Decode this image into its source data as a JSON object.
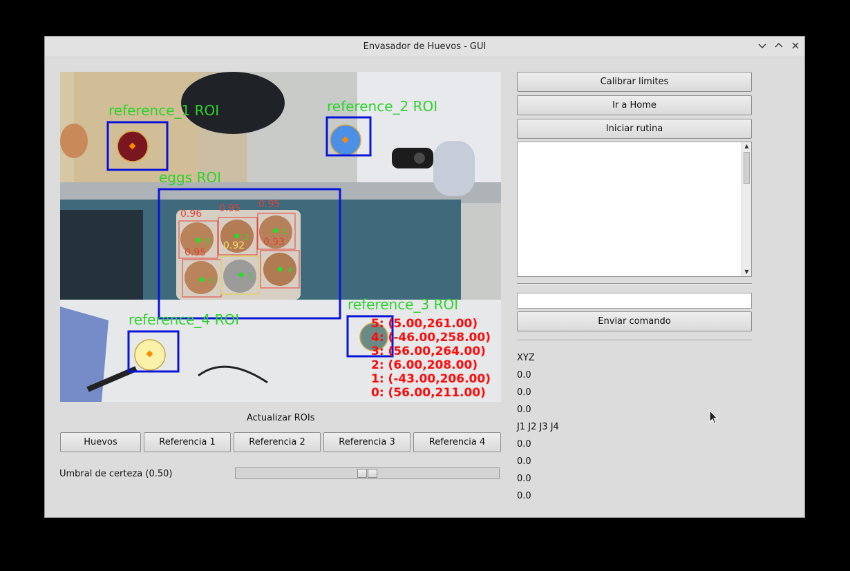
{
  "window": {
    "title": "Envasador de Huevos - GUI",
    "controls": [
      "chevron-down-icon",
      "chevron-up-icon",
      "close-icon"
    ]
  },
  "camera": {
    "roi_labels": {
      "ref1": "reference_1 ROI",
      "ref2": "reference_2 ROI",
      "ref3": "reference_3 ROI",
      "ref4": "reference_4 ROI",
      "eggs": "eggs ROI"
    },
    "egg_scores": [
      "0.96",
      "0.95",
      "0.95",
      "0.95",
      "0.93",
      "0.92"
    ],
    "egg_ids": [
      "0",
      "1",
      "2",
      "3",
      "4",
      "5"
    ],
    "coordinates": [
      "5: (5.00,261.00)",
      "4: (-46.00,258.00)",
      "3: (56.00,264.00)",
      "2: (6.00,208.00)",
      "1: (-43.00,206.00)",
      "0: (56.00,211.00)"
    ],
    "colors": {
      "roi_box": "#0a14d8",
      "roi_label": "#2bd42b",
      "score": "#e2433a",
      "coords": "#ff0a0a"
    }
  },
  "roi_section": {
    "title": "Actualizar ROIs",
    "buttons": [
      "Huevos",
      "Referencia 1",
      "Referencia 2",
      "Referencia 3",
      "Referencia 4"
    ]
  },
  "threshold": {
    "label": "Umbral de certeza (0.50)",
    "value": 0.5
  },
  "right_panel": {
    "buttons": {
      "calibrate": "Calibrar limites",
      "home": "Ir a Home",
      "start": "Iniciar rutina",
      "send": "Enviar comando"
    },
    "log_text": "",
    "command_value": "",
    "xyz_header": "XYZ",
    "xyz": [
      "0.0",
      "0.0",
      "0.0"
    ],
    "joints_header": "J1 J2 J3 J4",
    "joints": [
      "0.0",
      "0.0",
      "0.0",
      "0.0"
    ]
  }
}
